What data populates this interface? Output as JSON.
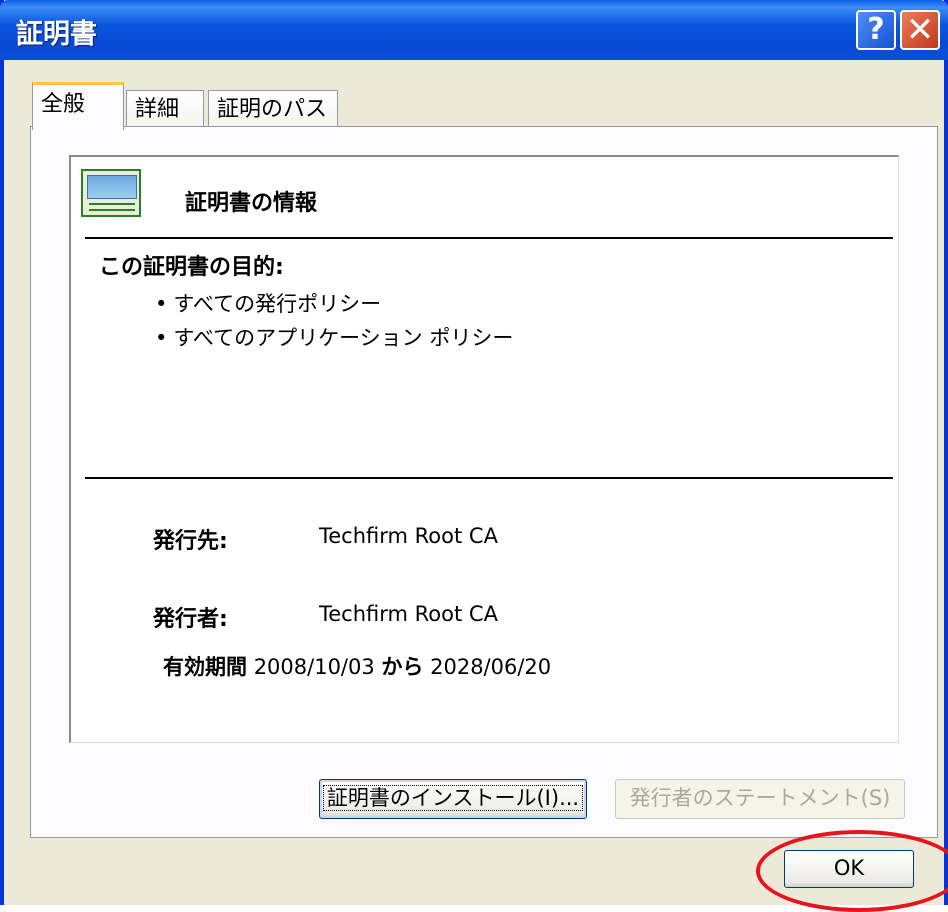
{
  "window": {
    "title": "証明書"
  },
  "titlebar_buttons": {
    "help": "?",
    "close": "✕"
  },
  "tabs": [
    {
      "label": "全般",
      "active": true
    },
    {
      "label": "詳細",
      "active": false
    },
    {
      "label": "証明のパス",
      "active": false
    }
  ],
  "info": {
    "heading": "証明書の情報",
    "purpose_title": "この証明書の目的:",
    "purposes": [
      "すべての発行ポリシー",
      "すべてのアプリケーション ポリシー"
    ],
    "issued_to_label": "発行先:",
    "issued_to": "Techfirm Root CA",
    "issued_by_label": "発行者:",
    "issued_by": "Techfirm Root CA",
    "validity_label": "有効期間",
    "valid_from": "2008/10/03",
    "from_to_word": "から",
    "valid_to": "2028/06/20"
  },
  "buttons": {
    "install": "証明書のインストール(I)...",
    "issuer_statement": "発行者のステートメント(S)",
    "ok": "OK"
  },
  "colors": {
    "annotation_circle": "#e8141c",
    "titlebar": "#0a4fd8"
  },
  "icons": {
    "cert": "certificate-icon"
  }
}
